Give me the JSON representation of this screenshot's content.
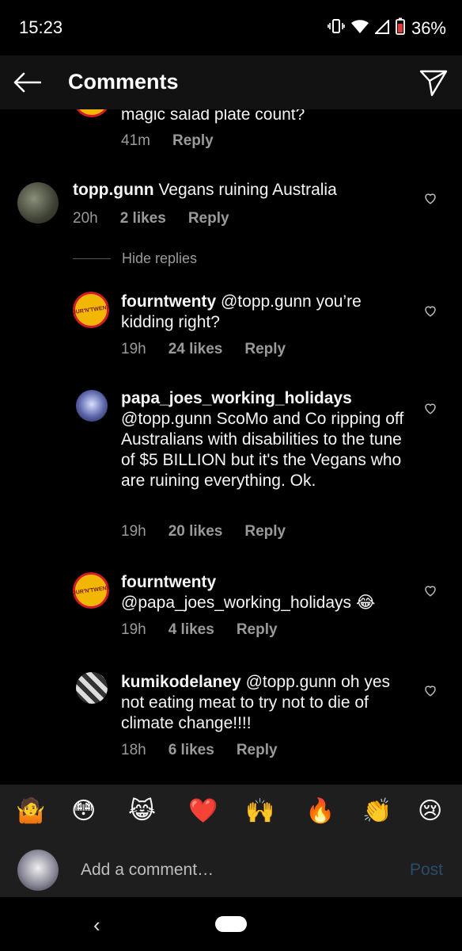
{
  "status_bar": {
    "time": "15:23",
    "battery": "36%"
  },
  "header": {
    "title": "Comments"
  },
  "comments": [
    {
      "user": "",
      "text": "magic salad plate count?",
      "age": "41m",
      "likes": "",
      "reply": "Reply"
    },
    {
      "user": "topp.gunn",
      "text": " Vegans ruining Australia",
      "age": "20h",
      "likes": "2 likes",
      "reply": "Reply"
    },
    {
      "user": "fourntwenty",
      "text": " @topp.gunn you’re kidding right?",
      "age": "19h",
      "likes": "24 likes",
      "reply": "Reply"
    },
    {
      "user": "papa_joes_working_holidays",
      "text": "@topp.gunn ScoMo and Co ripping off Australians with disabilities to the tune of $5 BILLION but it's the Vegans who are ruining everything. Ok.",
      "age": "19h",
      "likes": "20 likes",
      "reply": "Reply"
    },
    {
      "user": "fourntwenty",
      "text": " @papa_joes_working_holidays 😂",
      "age": "19h",
      "likes": "4 likes",
      "reply": "Reply"
    },
    {
      "user": "kumikodelaney",
      "text": " @topp.gunn oh yes not eating meat to try not to die of climate change!!!!",
      "age": "18h",
      "likes": "6 likes",
      "reply": "Reply"
    }
  ],
  "hide_replies": "Hide replies",
  "logo_text": "FOUR'N'TWENTY",
  "emoji_bar": [
    "🤷",
    "😳",
    "😹",
    "❤️",
    "🙌",
    "🔥",
    "👏",
    "😢"
  ],
  "input": {
    "placeholder": "Add a comment…",
    "post": "Post"
  },
  "nav": {
    "back": "‹"
  },
  "colors": {
    "background": "#000000",
    "header": "#121212",
    "bar": "#1e1e1e",
    "meta": "#9a9a9a",
    "post_disabled": "#2c4a6b"
  }
}
